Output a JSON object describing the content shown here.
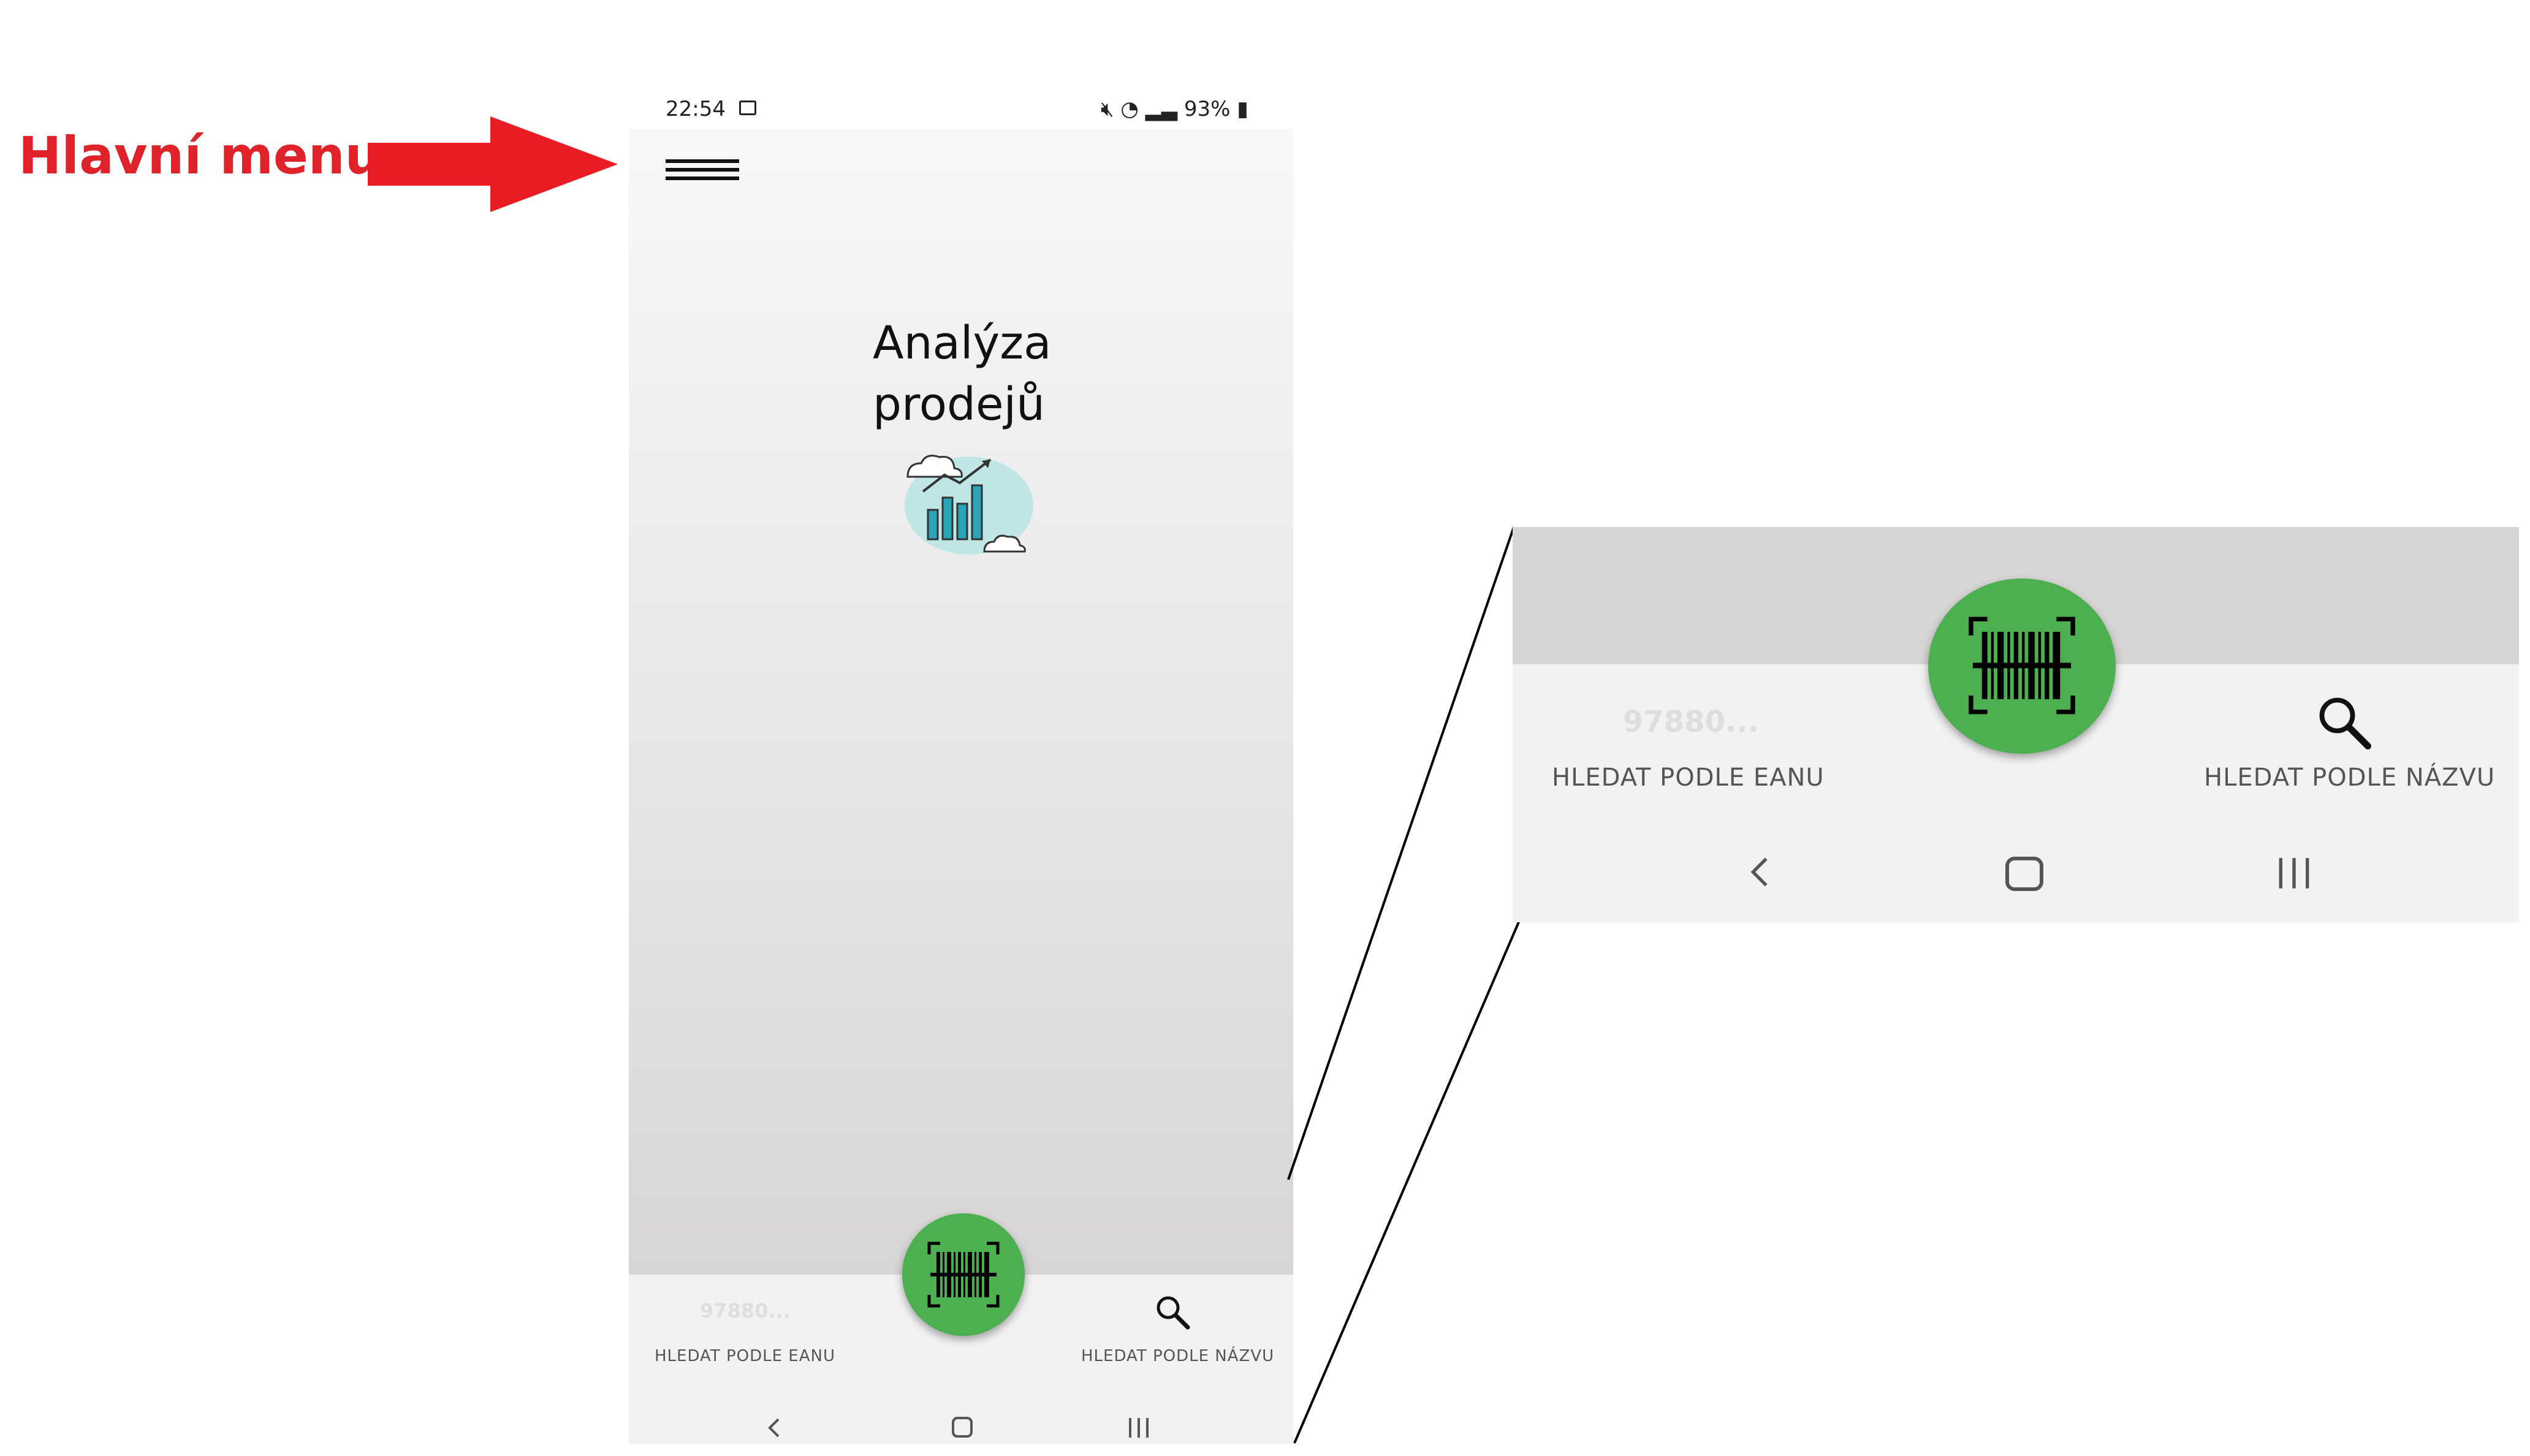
{
  "annotation": {
    "label": "Hlavní menu",
    "color": "#e0222a",
    "arrow": "arrow-right"
  },
  "status_bar": {
    "time": "22:54",
    "battery": "93%",
    "icons": [
      "image-icon",
      "mute-icon",
      "wifi-icon",
      "signal-icon",
      "battery-icon"
    ]
  },
  "app": {
    "menu_icon": "hamburger-icon",
    "title_line1": "Analýza",
    "title_line2": "prodejů",
    "illustration": "sales-chart-illustration"
  },
  "bottom_nav": {
    "ean_placeholder": "97880...",
    "search_ean_label": "HLEDAT PODLE EANU",
    "search_name_label": "HLEDAT PODLE NÁZVU",
    "scan_button": "barcode-scan-icon",
    "fab_color": "#4caf50"
  },
  "system_nav": [
    "back-icon",
    "home-icon",
    "recents-icon"
  ],
  "zoom": {
    "ean_placeholder": "97880...",
    "search_ean_label": "HLEDAT PODLE EANU",
    "search_name_label": "HLEDAT PODLE NÁZVU"
  }
}
